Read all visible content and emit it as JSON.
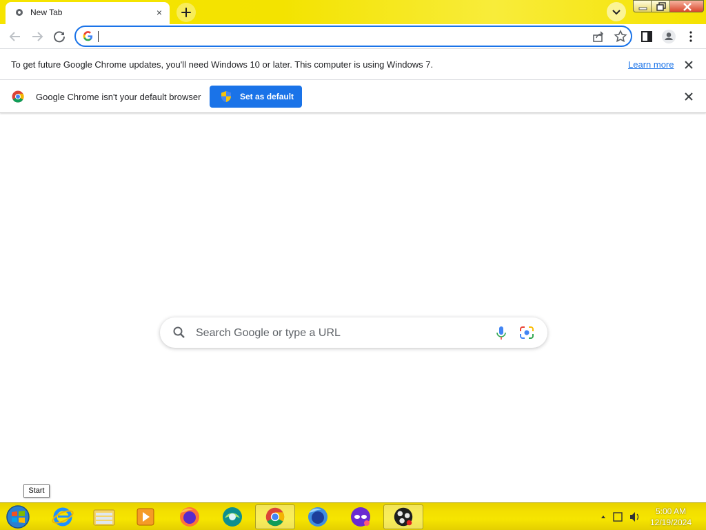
{
  "tab": {
    "title": "New Tab",
    "close_symbol": "×"
  },
  "omnibox": {
    "value": "",
    "placeholder": ""
  },
  "infobar_update": {
    "message": "To get future Google Chrome updates, you'll need Windows 10 or later. This computer is using Windows 7.",
    "learn_more": "Learn more"
  },
  "infobar_default": {
    "message": "Google Chrome isn't your default browser",
    "button_label": "Set as default"
  },
  "ntp": {
    "search_placeholder": "Search Google or type a URL"
  },
  "tooltip": {
    "text": "Start"
  },
  "clock": {
    "time": "5:00 AM",
    "date": "12/19/2024"
  },
  "taskbar": {
    "apps": [
      "internet-explorer-icon",
      "file-explorer-icon",
      "media-player-icon",
      "firefox-icon",
      "app-icon",
      "chrome-icon",
      "firefox-icon",
      "privacy-app-icon",
      "obs-icon"
    ],
    "active_app": "chrome-icon"
  },
  "colors": {
    "accent": "#1a73e8",
    "tabstrip": "#f6e400",
    "taskbar": "#f3df00"
  }
}
